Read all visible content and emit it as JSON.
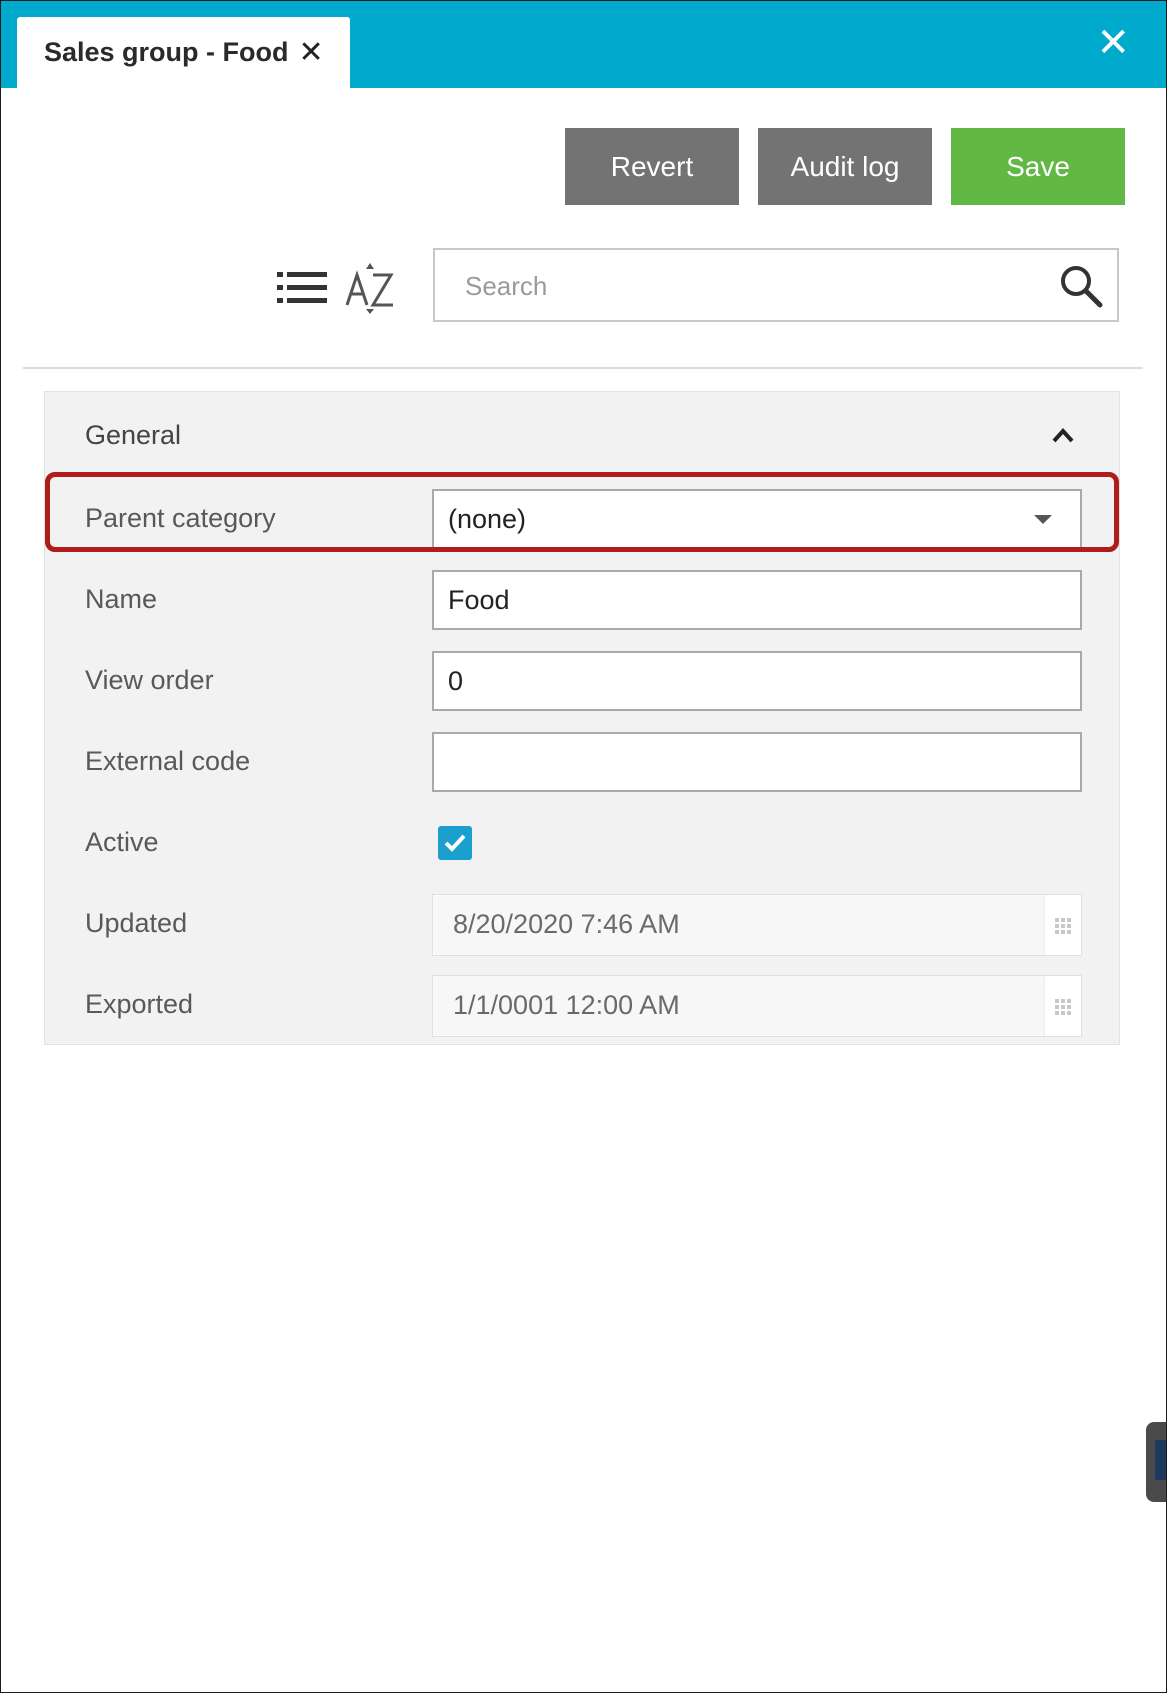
{
  "tab": {
    "title": "Sales group - Food",
    "close_glyph": "✕"
  },
  "window": {
    "close_glyph": "✕"
  },
  "toolbar": {
    "revert_label": "Revert",
    "audit_log_label": "Audit log",
    "save_label": "Save"
  },
  "view_controls": {
    "list_icon": "list-icon",
    "sort_icon": "sort-az-icon"
  },
  "search": {
    "placeholder": "Search",
    "value": ""
  },
  "section": {
    "title": "General",
    "collapsed": false,
    "fields": {
      "parent_category": {
        "label": "Parent category",
        "value": "(none)"
      },
      "name": {
        "label": "Name",
        "value": "Food"
      },
      "view_order": {
        "label": "View order",
        "value": "0"
      },
      "external_code": {
        "label": "External code",
        "value": ""
      },
      "active": {
        "label": "Active",
        "checked": true
      },
      "updated": {
        "label": "Updated",
        "value": "8/20/2020 7:46 AM"
      },
      "exported": {
        "label": "Exported",
        "value": "1/1/0001 12:00 AM"
      }
    }
  },
  "colors": {
    "header_bar": "#00aacd",
    "save_button": "#62b844",
    "secondary_button": "#737373",
    "checkbox": "#1a9fcf",
    "highlight": "#b01c1c"
  }
}
